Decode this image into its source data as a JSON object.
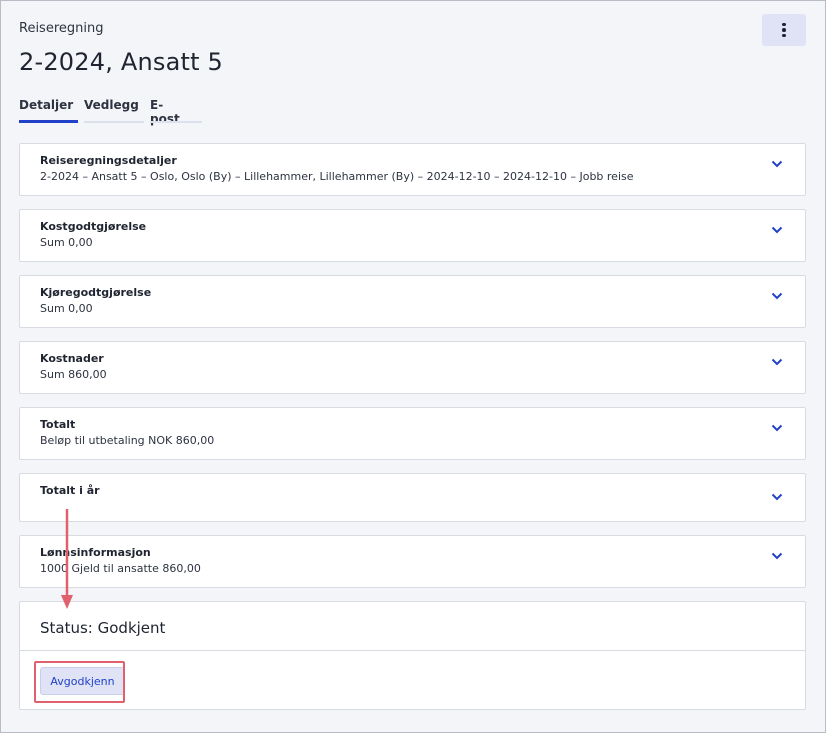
{
  "header": {
    "breadcrumb": "Reiseregning",
    "title": "2-2024, Ansatt 5",
    "menu_icon": "more-vertical-icon"
  },
  "tabs": [
    {
      "label": "Detaljer",
      "active": true
    },
    {
      "label": "Vedlegg",
      "active": false
    },
    {
      "label": "E-post",
      "active": false
    }
  ],
  "sections": [
    {
      "title": "Reiseregningsdetaljer",
      "subtitle": "2-2024  –  Ansatt 5  –  Oslo, Oslo (By)  –  Lillehammer, Lillehammer (By)  –  2024-12-10  –  2024-12-10  –  Jobb reise"
    },
    {
      "title": "Kostgodtgjørelse",
      "subtitle": "Sum 0,00"
    },
    {
      "title": "Kjøregodtgjørelse",
      "subtitle": "Sum 0,00"
    },
    {
      "title": "Kostnader",
      "subtitle": "Sum 860,00"
    },
    {
      "title": "Totalt",
      "subtitle": "Beløp til utbetaling NOK 860,00"
    },
    {
      "title": "Totalt i år",
      "subtitle": ""
    },
    {
      "title": "Lønnsinformasjon",
      "subtitle": "1000 Gjeld til ansatte 860,00"
    }
  ],
  "status": {
    "text": "Status: Godkjent",
    "button_label": "Avgodkjenn"
  },
  "colors": {
    "accent": "#2141c9",
    "button_bg": "#dfe3f5",
    "annotation_red": "#e0606b"
  }
}
